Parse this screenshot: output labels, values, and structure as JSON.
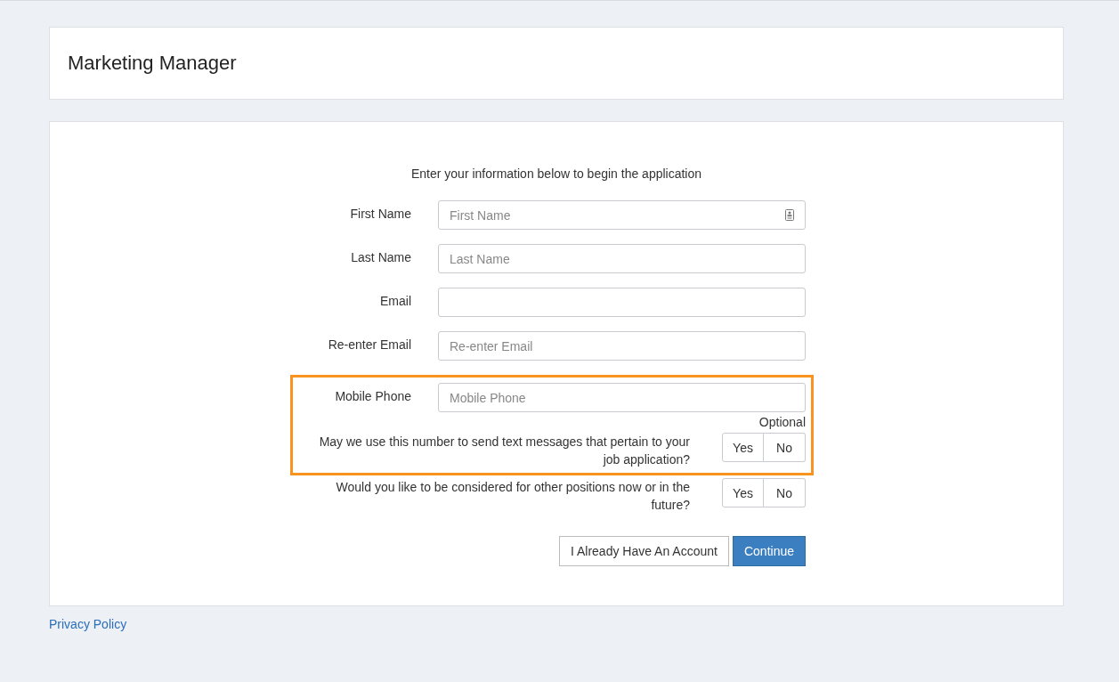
{
  "header": {
    "title": "Marketing Manager"
  },
  "form": {
    "intro": "Enter your information below to begin the application",
    "sections": [
      {
        "highlighted": false,
        "rows": [
          {
            "kind": "field",
            "label": "First Name",
            "placeholder": "First Name",
            "contact_card_icon": true
          },
          {
            "kind": "field",
            "label": "Last Name",
            "placeholder": "Last Name"
          },
          {
            "kind": "field",
            "label": "Email"
          },
          {
            "kind": "field",
            "label": "Re-enter Email",
            "placeholder": "Re-enter Email"
          }
        ]
      },
      {
        "highlighted": true,
        "rows": [
          {
            "kind": "field",
            "label": "Mobile Phone",
            "placeholder": "Mobile Phone",
            "note": "Optional"
          },
          {
            "kind": "question",
            "text": "May we use this number to send text messages that pertain to your job application?",
            "options": [
              {
                "label": "Yes",
                "selected": false
              },
              {
                "label": "No",
                "selected": false
              }
            ]
          }
        ]
      },
      {
        "highlighted": false,
        "rows": [
          {
            "kind": "question",
            "text": "Would you like to be considered for other positions now or in the future?",
            "options": [
              {
                "label": "Yes",
                "selected": false
              },
              {
                "label": "No",
                "selected": false
              }
            ]
          }
        ]
      }
    ],
    "buttons": [
      {
        "label": "I Already Have An Account",
        "kind": "secondary"
      },
      {
        "label": "Continue",
        "kind": "primary"
      }
    ]
  },
  "footer": {
    "link": "Privacy Policy"
  }
}
